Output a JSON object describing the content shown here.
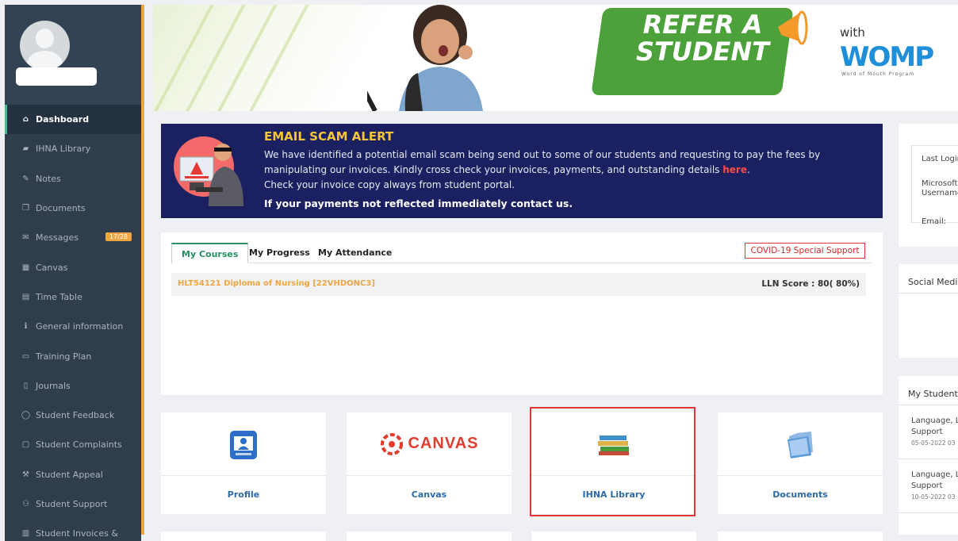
{
  "sidebar": {
    "items": [
      {
        "label": "Dashboard",
        "icon": "home-icon",
        "glyph": "⌂",
        "active": true
      },
      {
        "label": "IHNA Library",
        "icon": "book-icon",
        "glyph": "▰"
      },
      {
        "label": "Notes",
        "icon": "edit-icon",
        "glyph": "✎"
      },
      {
        "label": "Documents",
        "icon": "copy-icon",
        "glyph": "❐"
      },
      {
        "label": "Messages",
        "icon": "envelope-icon",
        "glyph": "✉",
        "badge": "17/28"
      },
      {
        "label": "Canvas",
        "icon": "grid-icon",
        "glyph": "▦"
      },
      {
        "label": "Time Table",
        "icon": "calendar-icon",
        "glyph": "▤"
      },
      {
        "label": "General information",
        "icon": "info-icon",
        "glyph": "ℹ"
      },
      {
        "label": "Training Plan",
        "icon": "calendar-icon",
        "glyph": "▭"
      },
      {
        "label": "Journals",
        "icon": "file-icon",
        "glyph": "▯"
      },
      {
        "label": "Student Feedback",
        "icon": "comment-icon",
        "glyph": "◯"
      },
      {
        "label": "Student Complaints",
        "icon": "comment-alt-icon",
        "glyph": "▢"
      },
      {
        "label": "Student Appeal",
        "icon": "gavel-icon",
        "glyph": "⚒"
      },
      {
        "label": "Student Support",
        "icon": "users-icon",
        "glyph": "⚇"
      },
      {
        "label": "Student Invoices &",
        "icon": "invoice-icon",
        "glyph": "▥"
      }
    ]
  },
  "banner": {
    "refer_line1": "REFER A",
    "refer_line2": "STUDENT",
    "with": "with",
    "womp": "WOMP",
    "womp_sub": "Word of Mouth Program"
  },
  "alert": {
    "title": "EMAIL SCAM ALERT",
    "line1": "We have identified a potential email scam being send out to some of our students and requesting to pay the fees by",
    "line2_pre": "manipulating our invoices.  Kindly cross check your invoices, payments, and outstanding details ",
    "line2_link": "here",
    "line2_post": ".",
    "line3": "Check your invoice copy always from student portal.",
    "line4": "If your payments not reflected immediately contact us."
  },
  "courses": {
    "tabs": [
      "My Courses",
      "My Progress",
      "My Attendance"
    ],
    "covid_button": "COVID-19 Special Support",
    "course_name": "HLT54121 Diploma of Nursing [22VHDONC3]",
    "lln_score": "LLN Score : 80( 80%)"
  },
  "tiles": [
    {
      "label": "Profile",
      "icon": "profile-icon"
    },
    {
      "label": "Canvas",
      "icon": "canvas-logo",
      "logo_text": "CANVAS"
    },
    {
      "label": "IHNA Library",
      "icon": "books-icon"
    },
    {
      "label": "Documents",
      "icon": "folder-icon"
    }
  ],
  "right": {
    "last_login": "Last Login",
    "microsoft": "Microsoft",
    "username": "Username",
    "email": "Email:",
    "social_media": "Social Media",
    "my_student": "My Student",
    "news": [
      {
        "line1": "Language, L",
        "line2": "Support",
        "date": "05-05-2022 03"
      },
      {
        "line1": "Language, L",
        "line2": "Support",
        "date": "10-05-2022 03"
      }
    ]
  }
}
